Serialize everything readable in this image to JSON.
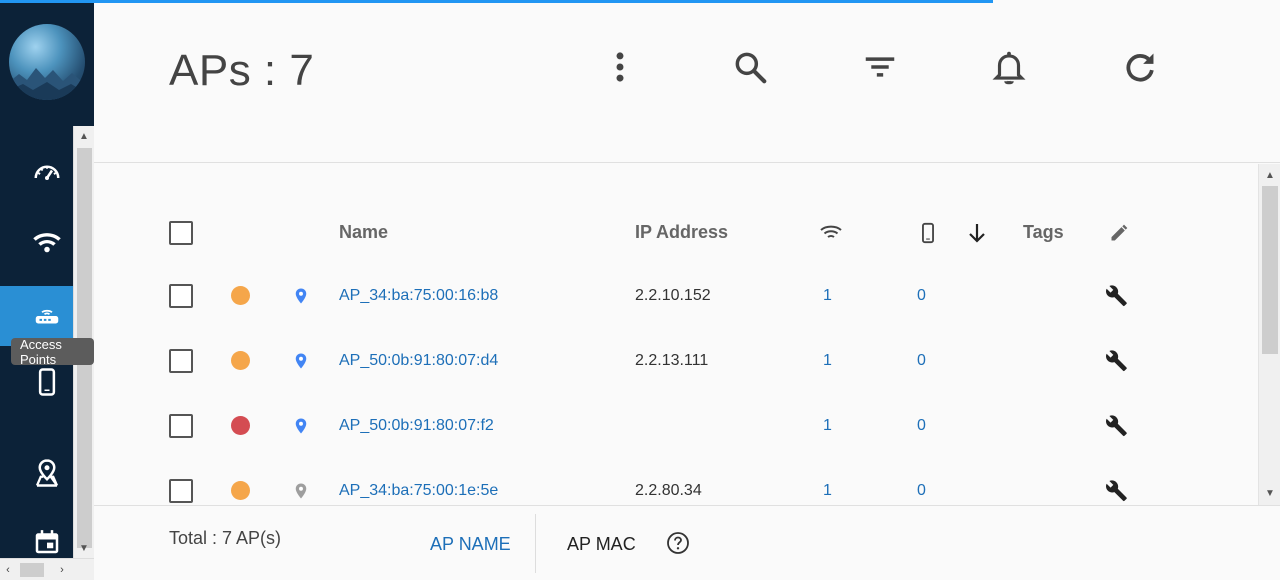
{
  "header": {
    "title": "APs : 7"
  },
  "sidebar": {
    "tooltip": "Access Points"
  },
  "table": {
    "headers": {
      "name": "Name",
      "ip": "IP Address",
      "tags": "Tags"
    },
    "rows": [
      {
        "status_color": "#f5a64a",
        "pin_color": "#4285f4",
        "name": "AP_34:ba:75:00:16:b8",
        "ip": "2.2.10.152",
        "wifi": "1",
        "clients": "0"
      },
      {
        "status_color": "#f5a64a",
        "pin_color": "#4285f4",
        "name": "AP_50:0b:91:80:07:d4",
        "ip": "2.2.13.111",
        "wifi": "1",
        "clients": "0"
      },
      {
        "status_color": "#d44c52",
        "pin_color": "#4285f4",
        "name": "AP_50:0b:91:80:07:f2",
        "ip": "",
        "wifi": "1",
        "clients": "0"
      },
      {
        "status_color": "#f5a64a",
        "pin_color": "#9e9e9e",
        "name": "AP_34:ba:75:00:1e:5e",
        "ip": "2.2.80.34",
        "wifi": "1",
        "clients": "0"
      }
    ]
  },
  "footer": {
    "total": "Total : 7 AP(s)",
    "ap_name_label": "AP NAME",
    "ap_mac_label": "AP MAC"
  },
  "colors": {
    "sidebar_bg": "#0c2238",
    "accent": "#2a8fd4",
    "link": "#1d6fb8"
  }
}
